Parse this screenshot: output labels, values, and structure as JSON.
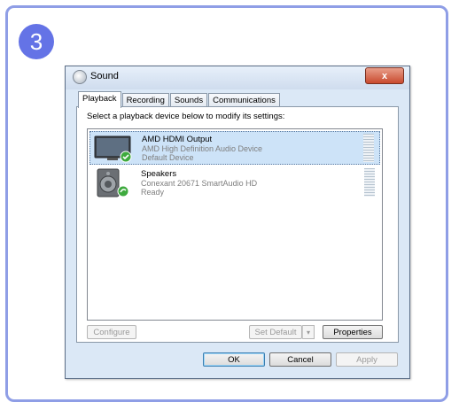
{
  "step": {
    "number": "3"
  },
  "dialog": {
    "title": "Sound",
    "close_label": "x",
    "tabs": [
      {
        "label": "Playback",
        "active": true
      },
      {
        "label": "Recording",
        "active": false
      },
      {
        "label": "Sounds",
        "active": false
      },
      {
        "label": "Communications",
        "active": false
      }
    ],
    "instruction": "Select a playback device below to modify its settings:",
    "devices": [
      {
        "name": "AMD HDMI Output",
        "description": "AMD High Definition Audio Device",
        "status": "Default Device",
        "selected": true,
        "icon": "monitor-icon"
      },
      {
        "name": "Speakers",
        "description": "Conexant 20671 SmartAudio HD",
        "status": "Ready",
        "selected": false,
        "icon": "speaker-icon"
      }
    ],
    "buttons": {
      "configure": "Configure",
      "set_default": "Set Default",
      "set_default_arrow": "▾",
      "properties": "Properties",
      "ok": "OK",
      "cancel": "Cancel",
      "apply": "Apply"
    }
  },
  "colors": {
    "badge": "#6473e6",
    "frame_border": "#8f9ee6",
    "selected_row": "#cde3f8",
    "close_button": "#c94a2e"
  }
}
